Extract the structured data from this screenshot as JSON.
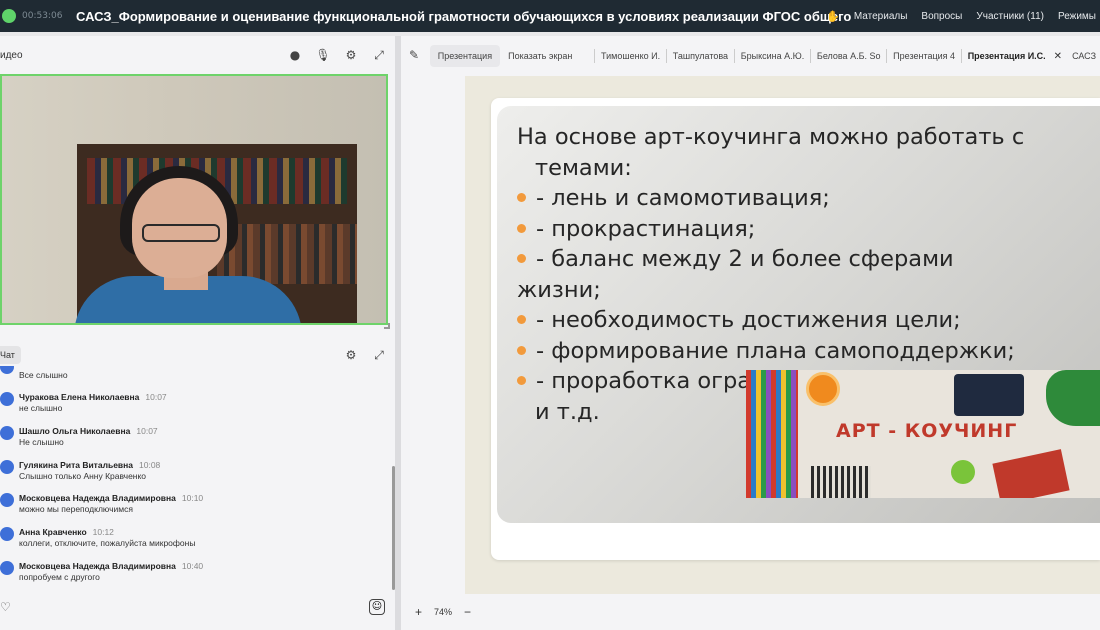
{
  "header": {
    "timer": "00:53:06",
    "title": "САСЗ_Формирование и оценивание функциональной грамотности обучающихся в условиях реализации ФГОС общего",
    "nav": [
      "Материалы",
      "Вопросы",
      "Участники (11)",
      "Режимы"
    ]
  },
  "video": {
    "label": "идео"
  },
  "chat": {
    "label": "Чат",
    "messages": [
      {
        "author": "",
        "time": "",
        "text": "Все слышно"
      },
      {
        "author": "Чуракова Елена Николаевна",
        "time": "10:07",
        "text": "не слышно"
      },
      {
        "author": "Шашло Ольга Николаевна",
        "time": "10:07",
        "text": "Не слышно"
      },
      {
        "author": "Гулякина Рита Витальевна",
        "time": "10:08",
        "text": "Слышно только Анну Кравченко"
      },
      {
        "author": "Московцева Надежда Владимировна",
        "time": "10:10",
        "text": "можно мы переподключимся"
      },
      {
        "author": "Анна Кравченко",
        "time": "10:12",
        "text": "коллеги, отключите, пожалуйста микрофоны"
      },
      {
        "author": "Московцева Надежда Владимировна",
        "time": "10:40",
        "text": "попробуем с другого"
      }
    ]
  },
  "tabs": {
    "presentation": "Презентация",
    "show_screen": "Показать экран",
    "items": [
      "Тимошенко И.",
      "Ташпулатова",
      "Брыксина А.Ю.",
      "Белова А.Б. So",
      "Презентация 4"
    ],
    "selected": "Презентация И.С.",
    "overflow": "САСЗ"
  },
  "slide": {
    "line1": "На основе арт-коучинга можно работать с",
    "line2": "темами:",
    "bullets": [
      "- лень и самомотивация;",
      "- прокрастинация;",
      "- баланс между 2 и более сферами",
      "- необходимость достижения цели;",
      "- формирование плана самоподдержки;",
      "- проработка ограничивающих убеждений"
    ],
    "continuation1": "жизни;",
    "continuation2": "и т.д.",
    "image_label": "АРТ - КОУЧИНГ"
  },
  "zoom": {
    "value": "74%"
  }
}
